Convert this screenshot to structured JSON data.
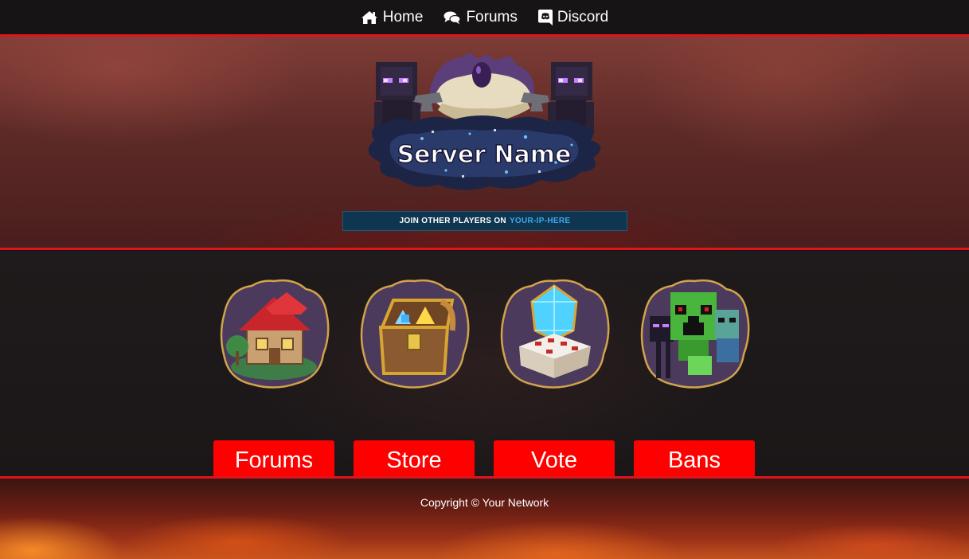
{
  "nav": {
    "items": [
      {
        "label": "Home",
        "icon": "home-icon"
      },
      {
        "label": "Forums",
        "icon": "comments-icon"
      },
      {
        "label": "Discord",
        "icon": "discord-icon"
      }
    ]
  },
  "hero": {
    "logo_text": "Server Name",
    "join_text": "JOIN OTHER PLAYERS ON",
    "server_ip": "YOUR-IP-HERE"
  },
  "features": [
    {
      "label": "Forums",
      "icon": "house-icon"
    },
    {
      "label": "Store",
      "icon": "treasure-chest-icon"
    },
    {
      "label": "Vote",
      "icon": "diamond-cake-icon"
    },
    {
      "label": "Bans",
      "icon": "creeper-mobs-icon"
    }
  ],
  "footer": {
    "copyright": "Copyright © Your Network"
  },
  "colors": {
    "accent_red": "#ff0000",
    "divider_red": "#e0141b",
    "ip_highlight": "#3fa8e8",
    "nav_bg": "#171415"
  }
}
